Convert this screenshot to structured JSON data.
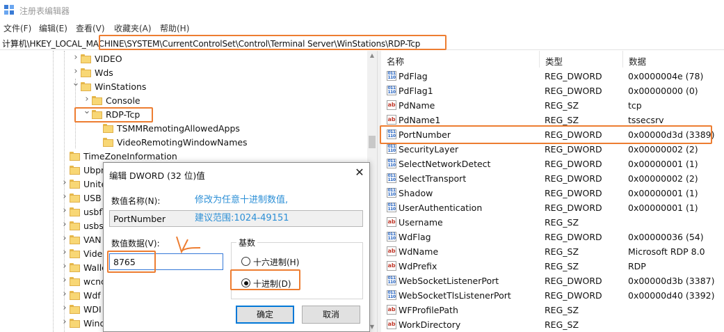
{
  "window": {
    "title": "注册表编辑器",
    "icon": "regedit-icon"
  },
  "menu": [
    "文件(F)",
    "编辑(E)",
    "查看(V)",
    "收藏夹(A)",
    "帮助(H)"
  ],
  "address": "计算机\\HKEY_LOCAL_MACHINE\\SYSTEM\\CurrentControlSet\\Control\\Terminal Server\\WinStations\\RDP-Tcp",
  "tree": {
    "items": [
      {
        "label": "VIDEO",
        "expander": "›"
      },
      {
        "label": "Wds",
        "expander": "›"
      },
      {
        "label": "WinStations",
        "expander": "⌄"
      },
      {
        "label": "Console",
        "expander": "›"
      },
      {
        "label": "RDP-Tcp",
        "expander": "⌄",
        "selected": true
      },
      {
        "label": "TSMMRemotingAllowedApps",
        "expander": ""
      },
      {
        "label": "VideoRemotingWindowNames",
        "expander": ""
      },
      {
        "label": "TimeZoneInformation",
        "expander": ""
      },
      {
        "label": "Ubpm",
        "expander": ""
      },
      {
        "label": "Unite",
        "expander": "›"
      },
      {
        "label": "USB",
        "expander": "›"
      },
      {
        "label": "usbfl",
        "expander": "›"
      },
      {
        "label": "usbst",
        "expander": "›"
      },
      {
        "label": "VAN",
        "expander": "›"
      },
      {
        "label": "Vide",
        "expander": "›"
      },
      {
        "label": "Walle",
        "expander": "›"
      },
      {
        "label": "wcnc",
        "expander": "›"
      },
      {
        "label": "Wdf",
        "expander": "›"
      },
      {
        "label": "WDI",
        "expander": "›"
      },
      {
        "label": "Wind",
        "expander": "›"
      }
    ]
  },
  "values": {
    "columns": [
      "名称",
      "类型",
      "数据"
    ],
    "rows": [
      {
        "icon": "dword",
        "name": "PdFlag",
        "type": "REG_DWORD",
        "data": "0x0000004e (78)"
      },
      {
        "icon": "dword",
        "name": "PdFlag1",
        "type": "REG_DWORD",
        "data": "0x00000000 (0)"
      },
      {
        "icon": "sz",
        "name": "PdName",
        "type": "REG_SZ",
        "data": "tcp"
      },
      {
        "icon": "sz",
        "name": "PdName1",
        "type": "REG_SZ",
        "data": "tssecsrv"
      },
      {
        "icon": "dword",
        "name": "PortNumber",
        "type": "REG_DWORD",
        "data": "0x00000d3d (3389)"
      },
      {
        "icon": "dword",
        "name": "SecurityLayer",
        "type": "REG_DWORD",
        "data": "0x00000002 (2)"
      },
      {
        "icon": "dword",
        "name": "SelectNetworkDetect",
        "type": "REG_DWORD",
        "data": "0x00000001 (1)"
      },
      {
        "icon": "dword",
        "name": "SelectTransport",
        "type": "REG_DWORD",
        "data": "0x00000002 (2)"
      },
      {
        "icon": "dword",
        "name": "Shadow",
        "type": "REG_DWORD",
        "data": "0x00000001 (1)"
      },
      {
        "icon": "dword",
        "name": "UserAuthentication",
        "type": "REG_DWORD",
        "data": "0x00000001 (1)"
      },
      {
        "icon": "sz",
        "name": "Username",
        "type": "REG_SZ",
        "data": ""
      },
      {
        "icon": "dword",
        "name": "WdFlag",
        "type": "REG_DWORD",
        "data": "0x00000036 (54)"
      },
      {
        "icon": "sz",
        "name": "WdName",
        "type": "REG_SZ",
        "data": "Microsoft RDP 8.0"
      },
      {
        "icon": "sz",
        "name": "WdPrefix",
        "type": "REG_SZ",
        "data": "RDP"
      },
      {
        "icon": "dword",
        "name": "WebSocketListenerPort",
        "type": "REG_DWORD",
        "data": "0x00000d3b (3387)"
      },
      {
        "icon": "dword",
        "name": "WebSocketTlsListenerPort",
        "type": "REG_DWORD",
        "data": "0x00000d40 (3392)"
      },
      {
        "icon": "sz",
        "name": "WFProfilePath",
        "type": "REG_SZ",
        "data": ""
      },
      {
        "icon": "sz",
        "name": "WorkDirectory",
        "type": "REG_SZ",
        "data": ""
      }
    ]
  },
  "dialog": {
    "title": "编辑 DWORD (32 位)值",
    "value_name_label": "数值名称(N):",
    "value_name": "PortNumber",
    "value_data_label": "数值数据(V):",
    "value_data": "8765",
    "base_label": "基数",
    "hex_label": "十六进制(H)",
    "dec_label": "十进制(D)",
    "selected_base": "dec",
    "ok_label": "确定",
    "cancel_label": "取消"
  },
  "annotation": {
    "line1": "修改为任意十进制数值,",
    "line2": "建议范围:1024-49151",
    "color": "#2c8fd6"
  },
  "highlight_color": "#ed7d31",
  "icons": {
    "sz": "ab",
    "dword": "011\n110"
  }
}
